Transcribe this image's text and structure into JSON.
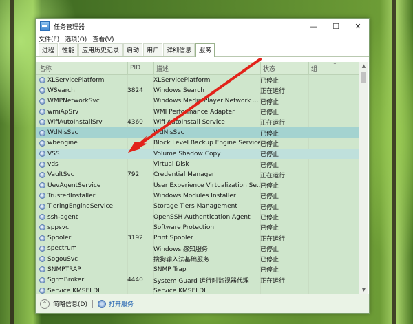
{
  "window": {
    "title": "任务管理器",
    "controls": {
      "minimize": "—",
      "maximize": "☐",
      "close": "✕"
    }
  },
  "menu": [
    "文件(F)",
    "选项(O)",
    "查看(V)"
  ],
  "tabs": [
    "进程",
    "性能",
    "应用历史记录",
    "启动",
    "用户",
    "详细信息",
    "服务"
  ],
  "active_tab": "服务",
  "columns": {
    "name": "名称",
    "pid": "PID",
    "desc": "描述",
    "status": "状态",
    "group": "组"
  },
  "services": [
    {
      "name": "XLServicePlatform",
      "pid": "",
      "desc": "XLServicePlatform",
      "status": "已停止",
      "group": ""
    },
    {
      "name": "WSearch",
      "pid": "3824",
      "desc": "Windows Search",
      "status": "正在运行",
      "group": ""
    },
    {
      "name": "WMPNetworkSvc",
      "pid": "",
      "desc": "Windows Media Player Network ...",
      "status": "已停止",
      "group": ""
    },
    {
      "name": "wmiApSrv",
      "pid": "",
      "desc": "WMI Performance Adapter",
      "status": "已停止",
      "group": ""
    },
    {
      "name": "WifiAutoInstallSrv",
      "pid": "4360",
      "desc": "Wifi AutoInstall Service",
      "status": "正在运行",
      "group": ""
    },
    {
      "name": "WdNisSvc",
      "pid": "",
      "desc": "WdNisSvc",
      "status": "已停止",
      "group": "",
      "state": "selected-strong"
    },
    {
      "name": "wbengine",
      "pid": "",
      "desc": "Block Level Backup Engine Service",
      "status": "已停止",
      "group": ""
    },
    {
      "name": "VSS",
      "pid": "",
      "desc": "Volume Shadow Copy",
      "status": "已停止",
      "group": "",
      "state": "selected"
    },
    {
      "name": "vds",
      "pid": "",
      "desc": "Virtual Disk",
      "status": "已停止",
      "group": ""
    },
    {
      "name": "VaultSvc",
      "pid": "792",
      "desc": "Credential Manager",
      "status": "正在运行",
      "group": ""
    },
    {
      "name": "UevAgentService",
      "pid": "",
      "desc": "User Experience Virtualization Se...",
      "status": "已停止",
      "group": ""
    },
    {
      "name": "TrustedInstaller",
      "pid": "",
      "desc": "Windows Modules Installer",
      "status": "已停止",
      "group": ""
    },
    {
      "name": "TieringEngineService",
      "pid": "",
      "desc": "Storage Tiers Management",
      "status": "已停止",
      "group": ""
    },
    {
      "name": "ssh-agent",
      "pid": "",
      "desc": "OpenSSH Authentication Agent",
      "status": "已停止",
      "group": ""
    },
    {
      "name": "sppsvc",
      "pid": "",
      "desc": "Software Protection",
      "status": "已停止",
      "group": ""
    },
    {
      "name": "Spooler",
      "pid": "3192",
      "desc": "Print Spooler",
      "status": "正在运行",
      "group": ""
    },
    {
      "name": "spectrum",
      "pid": "",
      "desc": "Windows 感知服务",
      "status": "已停止",
      "group": ""
    },
    {
      "name": "SogouSvc",
      "pid": "",
      "desc": "搜狗输入法基础服务",
      "status": "已停止",
      "group": ""
    },
    {
      "name": "SNMPTRAP",
      "pid": "",
      "desc": "SNMP Trap",
      "status": "已停止",
      "group": ""
    },
    {
      "name": "SgrmBroker",
      "pid": "4440",
      "desc": "System Guard 运行时监视器代理",
      "status": "正在运行",
      "group": ""
    },
    {
      "name": "Service KMSELDI",
      "pid": "",
      "desc": "Service KMSELDI",
      "status": "",
      "group": ""
    }
  ],
  "footer": {
    "less_details": "简略信息(D)",
    "open_services": "打开服务"
  },
  "icons": {
    "app": "task-manager-icon",
    "service": "service-gear-icon",
    "less": "chevron-up-circle-icon",
    "open": "services-icon"
  },
  "colors": {
    "arrow": "#e2231a",
    "selected_strong": "#a4d3d0",
    "selected": "#bfe0dc",
    "list_bg": "#cfe6cc"
  }
}
